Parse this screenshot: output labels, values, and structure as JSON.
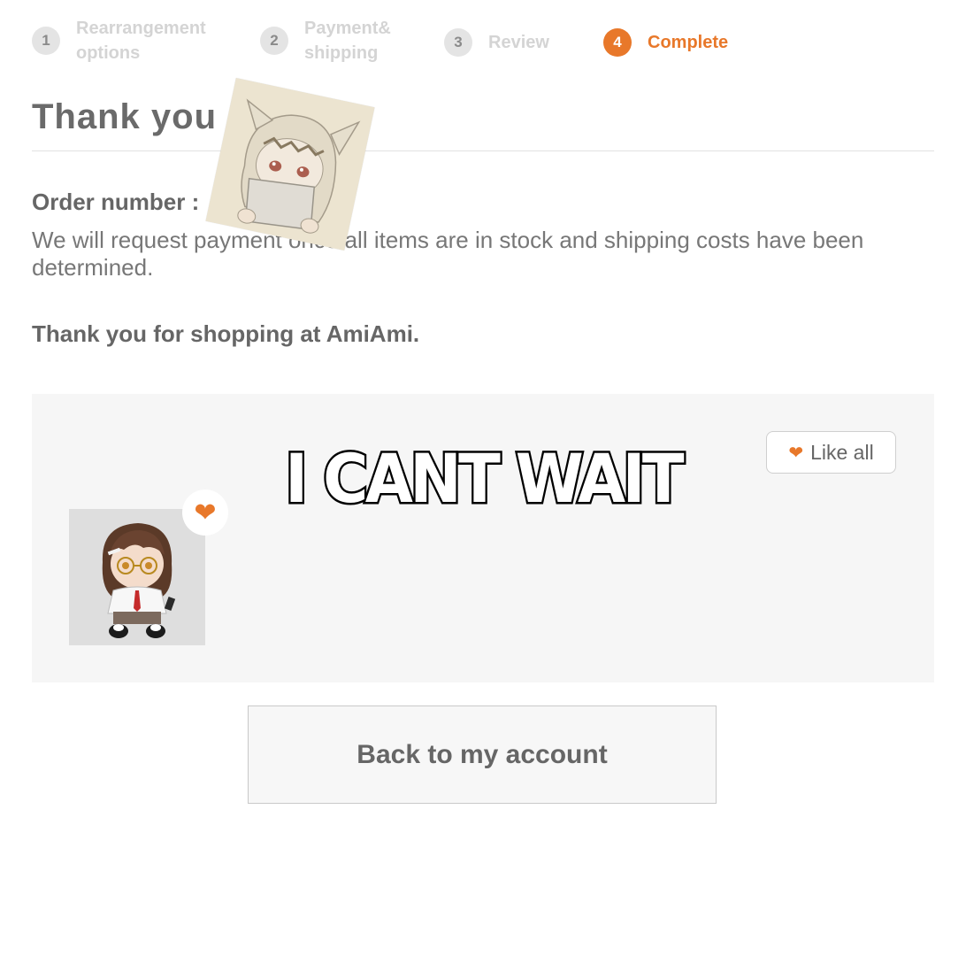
{
  "steps": [
    {
      "number": "1",
      "label": "Rearrangement options"
    },
    {
      "number": "2",
      "label": "Payment& shipping"
    },
    {
      "number": "3",
      "label": "Review"
    },
    {
      "number": "4",
      "label": "Complete"
    }
  ],
  "active_step": 4,
  "heading": "Thank you",
  "order": {
    "label": "Order number :",
    "payment_note": "We will request payment once all items are in stock and shipping costs have been determined.",
    "thanks": "Thank you for shopping at AmiAmi."
  },
  "items": {
    "like_all_label": "Like all"
  },
  "caption": "I CANT WAIT",
  "back_button_label": "Back to my account",
  "colors": {
    "accent": "#e8782a",
    "panel_bg": "#f6f6f6",
    "text": "#666666"
  },
  "icons": {
    "heart": "heart-icon",
    "like_all": "heart-icon"
  }
}
